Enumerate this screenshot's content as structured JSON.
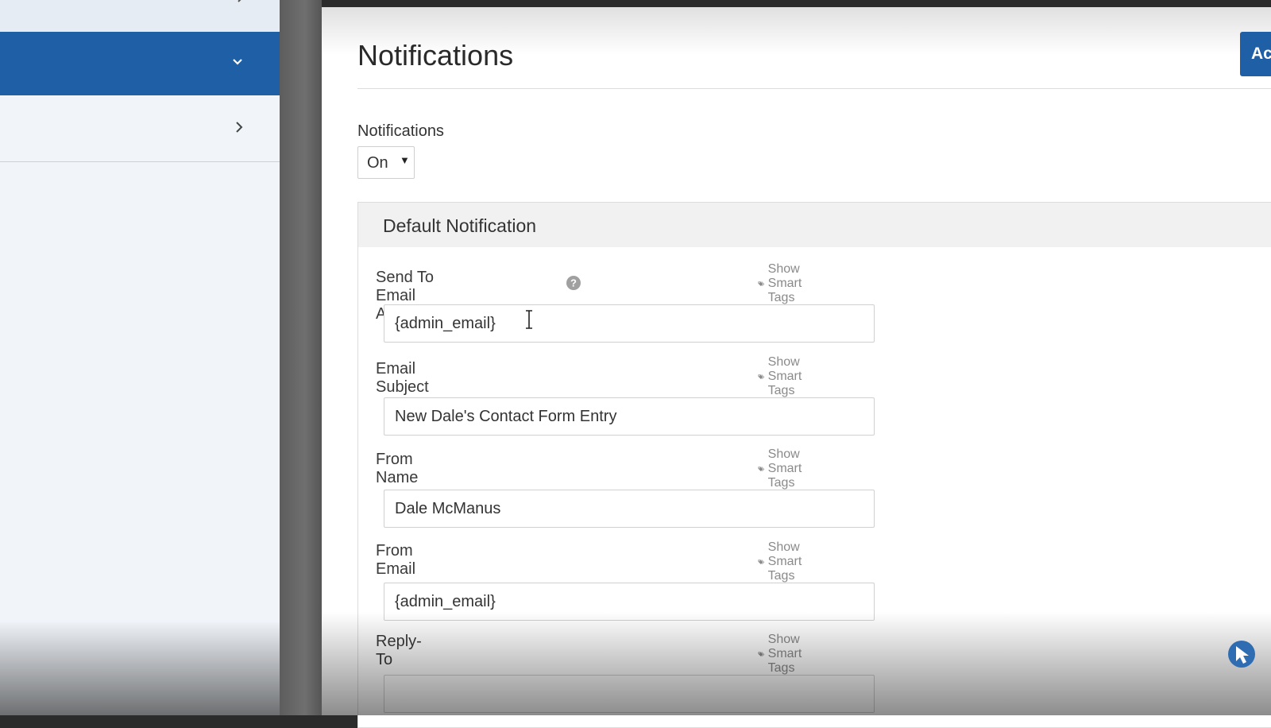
{
  "header": {
    "title": "Notifications",
    "add_button_label": "Ac"
  },
  "notifications_toggle": {
    "label": "Notifications",
    "selected": "On"
  },
  "default_notification": {
    "title": "Default Notification",
    "smart_tags_label": "Show Smart Tags",
    "fields": {
      "send_to": {
        "label": "Send To Email Address",
        "value": "{admin_email}"
      },
      "subject": {
        "label": "Email Subject",
        "value": "New Dale's Contact Form Entry"
      },
      "from_name": {
        "label": "From Name",
        "value": "Dale McManus"
      },
      "from_email": {
        "label": "From Email",
        "value": "{admin_email}"
      },
      "reply_to": {
        "label": "Reply-To",
        "value": ""
      }
    }
  },
  "icons": {
    "sidebar_active_chevron": "chevron-down-icon",
    "sidebar_item_chevron": "chevron-right-icon",
    "help": "question-circle-icon",
    "smart_tags": "tags-icon",
    "corner_logo": "cursor-logo-icon"
  },
  "colors": {
    "accent": "#1f5fa5",
    "sidebar_bg": "#f1f5fa",
    "card_header_bg": "#f1f1f1",
    "muted_text": "#8a8a8a"
  }
}
